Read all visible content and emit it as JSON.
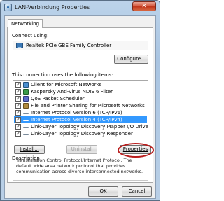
{
  "window": {
    "title": "LAN-Verbindung Properties",
    "close_glyph": "✕"
  },
  "tabs": [
    {
      "label": "Networking"
    }
  ],
  "connect": {
    "label": "Connect using:",
    "adapter": "Realtek PCIe GBE Family Controller",
    "configure_label": "Configure..."
  },
  "items_label": "This connection uses the following items:",
  "items": [
    {
      "label": "Client for Microsoft Networks",
      "checked": true,
      "icon": "network-client-icon"
    },
    {
      "label": "Kaspersky Anti-Virus NDIS 6 Filter",
      "checked": true,
      "icon": "antivirus-filter-icon"
    },
    {
      "label": "QoS Packet Scheduler",
      "checked": true,
      "icon": "qos-scheduler-icon"
    },
    {
      "label": "File and Printer Sharing for Microsoft Networks",
      "checked": true,
      "icon": "file-sharing-icon"
    },
    {
      "label": "Internet Protocol Version 6 (TCP/IPv6)",
      "checked": true,
      "icon": "protocol-icon"
    },
    {
      "label": "Internet Protocol Version 4 (TCP/IPv4)",
      "checked": true,
      "icon": "protocol-icon",
      "selected": true
    },
    {
      "label": "Link-Layer Topology Discovery Mapper I/O Driver",
      "checked": true,
      "icon": "protocol-icon"
    },
    {
      "label": "Link-Layer Topology Discovery Responder",
      "checked": true,
      "icon": "protocol-icon"
    }
  ],
  "buttons": {
    "install": "Install...",
    "uninstall": "Uninstall",
    "properties": "Properties",
    "ok": "OK",
    "cancel": "Cancel"
  },
  "description": {
    "label": "Description",
    "text": "Transmission Control Protocol/Internet Protocol. The default wide area network protocol that provides communication across diverse interconnected networks."
  },
  "colors": {
    "selection": "#3399ff",
    "highlight_ring": "#b91c1c"
  },
  "check_glyph": "✓"
}
